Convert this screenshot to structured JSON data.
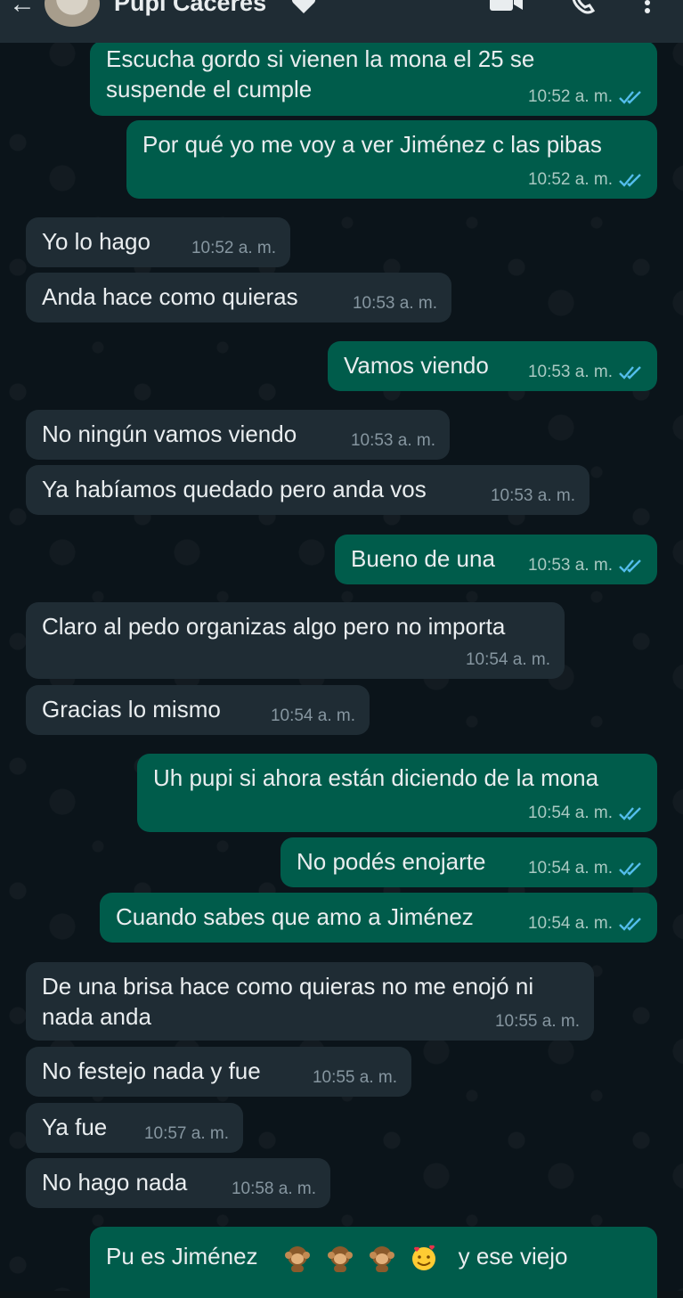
{
  "header": {
    "contact_name": "Pupi Cáceres",
    "back_icon": "arrow-left-icon",
    "icons": [
      "heart-icon",
      "video-call-icon",
      "phone-icon",
      "more-options-icon"
    ]
  },
  "colors": {
    "header_bg": "#1f2c34",
    "outgoing_bubble": "#005c4b",
    "incoming_bubble": "#1f2c34",
    "read_ticks": "#53bdeb",
    "chat_bg": "#0b141a"
  },
  "messages": [
    {
      "dir": "out",
      "text": "Escucha gordo si vienen la mona el 25 se suspende el cumple",
      "time": "10:52 a. m.",
      "read": true
    },
    {
      "dir": "out",
      "text": "Por qué yo me voy a ver Jiménez c las pibas",
      "time": "10:52 a. m.",
      "read": true
    },
    {
      "dir": "in",
      "text": "Yo lo hago",
      "time": "10:52 a. m."
    },
    {
      "dir": "in",
      "text": "Anda hace como quieras",
      "time": "10:53 a. m."
    },
    {
      "dir": "out",
      "text": "Vamos viendo",
      "time": "10:53 a. m.",
      "read": true
    },
    {
      "dir": "in",
      "text": "No ningún vamos viendo",
      "time": "10:53 a. m."
    },
    {
      "dir": "in",
      "text": "Ya habíamos quedado pero anda vos",
      "time": "10:53 a. m."
    },
    {
      "dir": "out",
      "text": "Bueno de una",
      "time": "10:53 a. m.",
      "read": true
    },
    {
      "dir": "in",
      "text": "Claro al pedo organizas algo pero no importa",
      "time": "10:54 a. m."
    },
    {
      "dir": "in",
      "text": "Gracias lo mismo",
      "time": "10:54 a. m."
    },
    {
      "dir": "out",
      "text": "Uh pupi si ahora están diciendo de la mona",
      "time": "10:54 a. m.",
      "read": true
    },
    {
      "dir": "out",
      "text": "No podés enojarte",
      "time": "10:54 a. m.",
      "read": true
    },
    {
      "dir": "out",
      "text": "Cuando sabes que amo a Jiménez",
      "time": "10:54 a. m.",
      "read": true
    },
    {
      "dir": "in",
      "text": "De una brisa hace como quieras no me enojó ni nada anda",
      "time": "10:55 a. m."
    },
    {
      "dir": "in",
      "text": "No festejo nada y fue",
      "time": "10:55 a. m."
    },
    {
      "dir": "in",
      "text": "Ya fue",
      "time": "10:57 a. m."
    },
    {
      "dir": "in",
      "text": "No hago nada",
      "time": "10:58 a. m."
    },
    {
      "dir": "out",
      "text_before": "Pu es Jiménez",
      "emojis": [
        "monkey-emoji",
        "monkey-emoji",
        "monkey-emoji",
        "smiling-face-with-hearts-emoji"
      ],
      "text_after": "y ese viejo",
      "partial": true
    }
  ]
}
